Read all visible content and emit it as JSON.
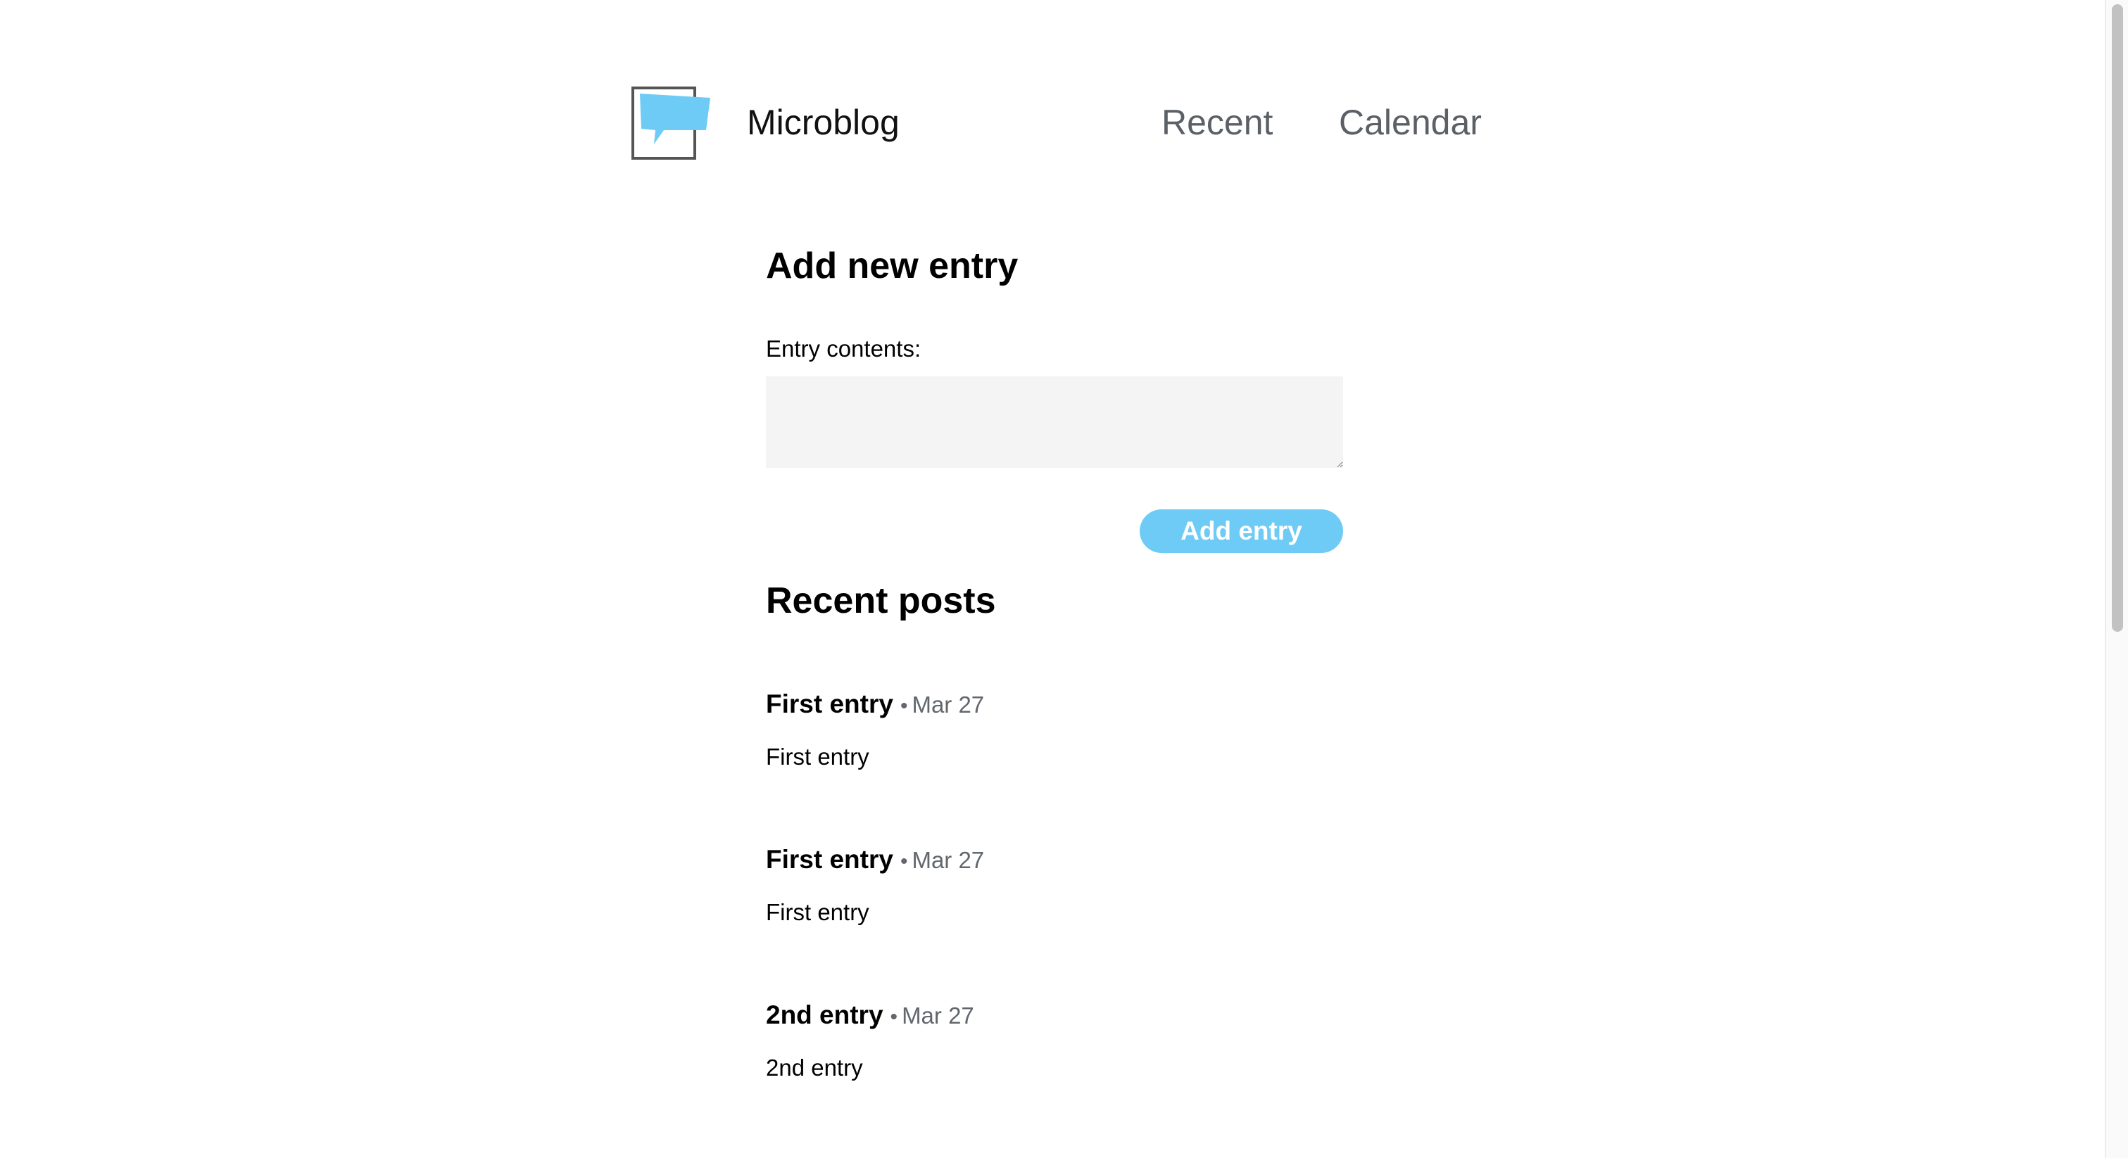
{
  "header": {
    "brand": "Microblog",
    "nav": [
      {
        "label": "Recent"
      },
      {
        "label": "Calendar"
      }
    ],
    "logo_icon": "speech-bubble-icon",
    "accent_color": "#6ecbf5"
  },
  "form": {
    "heading": "Add new entry",
    "field_label": "Entry contents:",
    "textarea_value": "",
    "submit_label": "Add entry"
  },
  "recent": {
    "heading": "Recent posts",
    "separator": "•",
    "posts": [
      {
        "title": "First entry",
        "date": "Mar 27",
        "body": "First entry"
      },
      {
        "title": "First entry",
        "date": "Mar 27",
        "body": "First entry"
      },
      {
        "title": "2nd entry",
        "date": "Mar 27",
        "body": "2nd entry"
      }
    ]
  }
}
